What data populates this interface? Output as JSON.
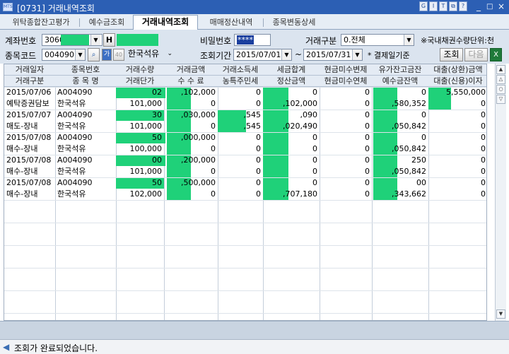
{
  "window": {
    "title": "[0731] 거래내역조회",
    "toolbar_icons": [
      "G",
      "I",
      "T",
      "?"
    ],
    "controls": [
      "_",
      "□",
      "×"
    ]
  },
  "tabs": [
    {
      "label": "위탁종합잔고평가"
    },
    {
      "label": "예수금조회"
    },
    {
      "label": "거래내역조회"
    },
    {
      "label": "매매정산내역"
    },
    {
      "label": "종목변동상세"
    }
  ],
  "form": {
    "account_label": "계좌번호",
    "account_value": "3060",
    "account_h": "H",
    "password_label": "비밀번호",
    "password_value": "****",
    "trade_type_label": "거래구분",
    "trade_type_value": "0.전체",
    "note": "※국내채권수량단위:천",
    "stock_code_label": "종목코드",
    "stock_code_value": "004090",
    "stock_name": "한국석유",
    "period_label": "조회기간",
    "date_from": "2015/07/01",
    "tilde": "~",
    "date_to": "2015/07/31",
    "basis_note": "* 결제일기준",
    "search_button": "조회",
    "next_button": "다음"
  },
  "grid": {
    "header1": [
      "거래일자",
      "종목번호",
      "거래수량",
      "거래금액",
      "거래소득세",
      "세금합계",
      "현금미수변제",
      "유가잔고금잔",
      "대출(상환)금액"
    ],
    "header2": [
      "거래구분",
      "종 목 명",
      "거래단가",
      "수  수  료",
      "농특주민세",
      "정산금액",
      "현금미수연체",
      "예수금잔액",
      "대출(신용)이자"
    ],
    "rows": [
      [
        "2015/07/06",
        "A004090",
        "02",
        ",102,000",
        "0",
        "0",
        "0",
        "0",
        "5,550,000"
      ],
      [
        "예탁증권담보",
        "한국석유",
        "101,000",
        "0",
        "0",
        ",102,000",
        "0",
        ",580,352",
        "0"
      ],
      [
        "2015/07/07",
        "A004090",
        "30",
        ",030,000",
        ",545",
        ",090",
        "0",
        "0",
        "0"
      ],
      [
        "매도-장내",
        "한국석유",
        "101,000",
        "0",
        ",545",
        ",020,490",
        "0",
        ",050,842",
        "0"
      ],
      [
        "2015/07/08",
        "A004090",
        "50",
        ",000,000",
        "0",
        "0",
        "0",
        "0",
        "0"
      ],
      [
        "매수-장내",
        "한국석유",
        "100,000",
        "0",
        "0",
        "0",
        "0",
        ",050,842",
        "0"
      ],
      [
        "2015/07/08",
        "A004090",
        "00",
        ",200,000",
        "0",
        "0",
        "0",
        "250",
        "0"
      ],
      [
        "매수-장내",
        "한국석유",
        "101,000",
        "0",
        "0",
        "0",
        "0",
        ",050,842",
        "0"
      ],
      [
        "2015/07/08",
        "A004090",
        "50",
        ",500,000",
        "0",
        "0",
        "0",
        "00",
        "0"
      ],
      [
        "매수-장내",
        "한국석유",
        "102,000",
        "0",
        "0",
        ",707,180",
        "0",
        ",343,662",
        "0"
      ]
    ]
  },
  "status": {
    "message": "조회가 완료되었습니다."
  },
  "colors": {
    "title_bar": "#2c5fb4",
    "redaction": "#1fd179",
    "panel": "#dbe4ef"
  }
}
